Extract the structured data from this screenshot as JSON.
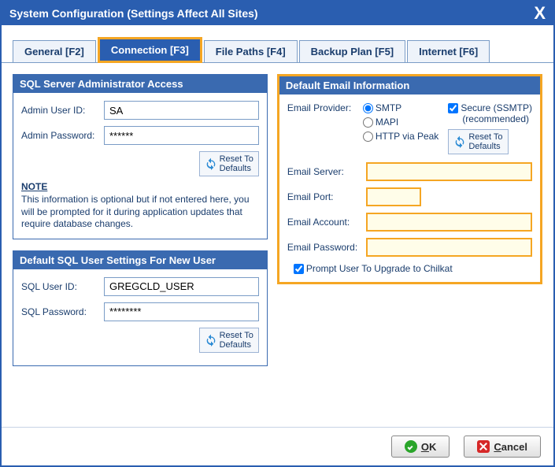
{
  "title": "System Configuration (Settings Affect All Sites)",
  "tabs": {
    "general": "General [F2]",
    "connection": "Connection [F3]",
    "filepaths": "File Paths [F4]",
    "backup": "Backup  Plan [F5]",
    "internet": "Internet [F6]"
  },
  "sqlAdmin": {
    "header": "SQL Server Administrator Access",
    "userLabel": "Admin User ID:",
    "userValue": "SA",
    "passLabel": "Admin Password:",
    "passValue": "******",
    "resetLabel": "Reset To\nDefaults",
    "noteTitle": "NOTE",
    "noteText": "This information is optional but if not entered here, you will be prompted for it during application updates that require database changes."
  },
  "sqlUser": {
    "header": "Default SQL User Settings For New User",
    "userLabel": "SQL User ID:",
    "userValue": "GREGCLD_USER",
    "passLabel": "SQL Password:",
    "passValue": "********",
    "resetLabel": "Reset To\nDefaults"
  },
  "email": {
    "header": "Default Email Information",
    "providerLabel": "Email Provider:",
    "optSMTP": "SMTP",
    "optMAPI": "MAPI",
    "optHTTP": "HTTP via Peak",
    "secureLabel": "Secure (SSMTP)",
    "secureSub": "(recommended)",
    "resetLabel": "Reset To\nDefaults",
    "serverLabel": "Email Server:",
    "serverValue": "",
    "portLabel": "Email Port:",
    "portValue": "",
    "accountLabel": "Email Account:",
    "accountValue": "",
    "passwordLabel": "Email Password:",
    "passwordValue": "",
    "promptLabel": "Prompt User To Upgrade to Chilkat"
  },
  "buttons": {
    "okFirst": "O",
    "okRest": "K",
    "cancelFirst": "C",
    "cancelRest": "ancel"
  }
}
